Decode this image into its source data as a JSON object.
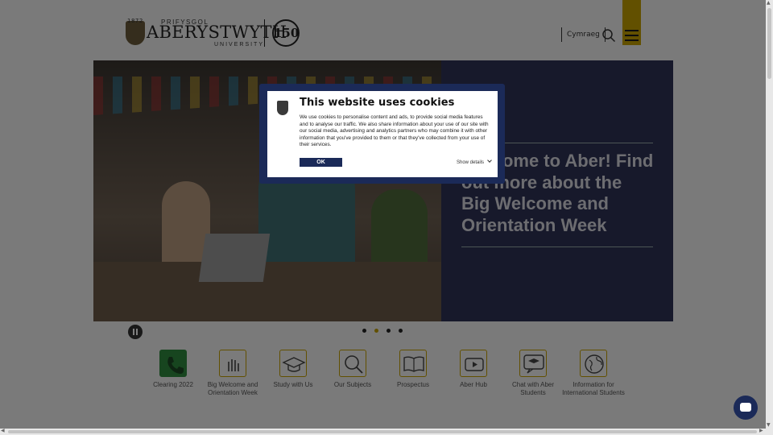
{
  "header": {
    "logo": {
      "year": "1872",
      "line1": "PRIFYSGOL",
      "line2": "ABERYSTWYTH",
      "line3": "UNIVERSITY",
      "anniversary": "150"
    },
    "language_link": "Cymraeg",
    "search_icon": "search-icon",
    "menu_icon": "hamburger-icon",
    "accent_color": "#c4a000"
  },
  "hero": {
    "title": "Welcome to Aber! Find out more about the Big Welcome and Orientation Week",
    "panel_color": "#2f3356",
    "slides_total": 4,
    "active_slide": 2
  },
  "carousel": {
    "pause_icon": "pause-icon"
  },
  "quick_links": [
    {
      "label": "Clearing 2022",
      "icon": "phone-icon"
    },
    {
      "label": "Big Welcome and Orientation Week",
      "icon": "waving-hand-icon"
    },
    {
      "label": "Study with Us",
      "icon": "graduation-cap-icon"
    },
    {
      "label": "Our Subjects",
      "icon": "search-icon"
    },
    {
      "label": "Prospectus",
      "icon": "book-icon"
    },
    {
      "label": "Aber Hub",
      "icon": "play-icon"
    },
    {
      "label": "Chat with Aber Students",
      "icon": "chat-student-icon"
    },
    {
      "label": "Information for International Students",
      "icon": "globe-icon"
    }
  ],
  "cookie_dialog": {
    "title": "This website uses cookies",
    "body": "We use cookies to personalise content and ads, to provide social media features and to analyse our traffic. We also share information about your use of our site with our social media, advertising and analytics partners who may combine it with other information that you've provided to them or that they've collected from your use of their services.",
    "ok_label": "OK",
    "details_label": "Show details",
    "brand_color": "#1b2a58"
  },
  "chat_widget_icon": "chat-bubble-icon"
}
